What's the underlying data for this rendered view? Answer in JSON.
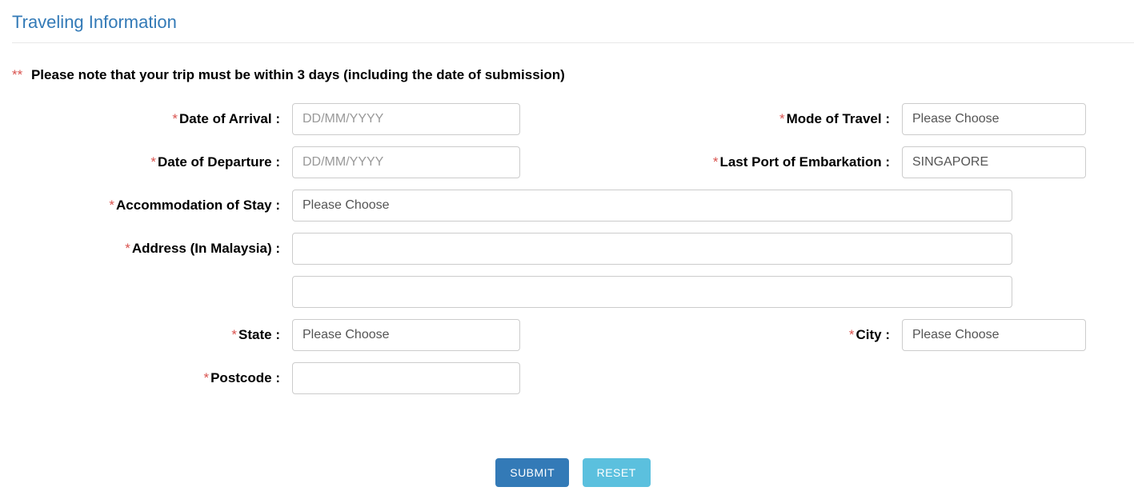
{
  "section": {
    "title": "Traveling Information"
  },
  "note": {
    "star": "**",
    "text": "Please note that your trip must be within 3 days (including the date of submission)"
  },
  "labels": {
    "arrival": "Date of Arrival :",
    "departure": "Date of Departure :",
    "mode": "Mode of Travel :",
    "embarkation": "Last Port of Embarkation :",
    "accommodation": "Accommodation of Stay :",
    "address": "Address (In Malaysia) :",
    "state": "State :",
    "city": "City :",
    "postcode": "Postcode :"
  },
  "placeholders": {
    "date": "DD/MM/YYYY",
    "choose": "Please Choose"
  },
  "values": {
    "embarkation": "SINGAPORE",
    "arrival": "",
    "departure": "",
    "mode": "Please Choose",
    "accommodation": "Please Choose",
    "address1": "",
    "address2": "",
    "state": "Please Choose",
    "city": "Please Choose",
    "postcode": ""
  },
  "buttons": {
    "submit": "SUBMIT",
    "reset": "RESET"
  },
  "req": "*"
}
